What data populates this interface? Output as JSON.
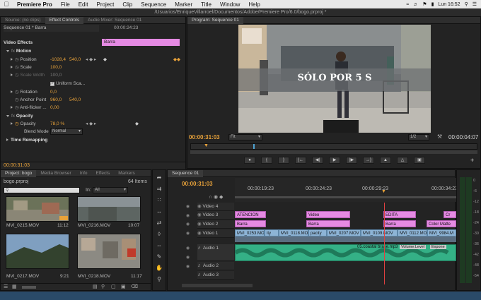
{
  "menubar": {
    "items": [
      "Premiere Pro",
      "File",
      "Edit",
      "Project",
      "Clip",
      "Sequence",
      "Marker",
      "Title",
      "Window",
      "Help"
    ],
    "clock": "Lun 16:52"
  },
  "window_title": "/Usuarios/EnriqueVillarroel/Documentos/Adobe/Premiere Pro/6.0/bogo.prproj *",
  "effect_controls": {
    "tabs": [
      "Source: (no clips)",
      "Effect Controls",
      "Audio Mixer: Sequence 01"
    ],
    "sequence_label": "Sequence 01 * Barra",
    "timecode_head": "00:00:24:23",
    "clip_name": "Barra",
    "video_effects": "Video Effects",
    "motion": "Motion",
    "position_label": "Position",
    "position_x": "-1028,4",
    "position_y": "540,0",
    "scale_label": "Scale",
    "scale_val": "100,0",
    "scale_width_label": "Scale Width",
    "scale_width_val": "100,0",
    "uniform_scale": "Uniform Sca...",
    "rotation_label": "Rotation",
    "rotation_val": "0,0",
    "anchor_label": "Anchor Point",
    "anchor_x": "960,0",
    "anchor_y": "540,0",
    "antiflicker_label": "Anti-flicker ...",
    "antiflicker_val": "0,00",
    "opacity_group": "Opacity",
    "opacity_label": "Opacity",
    "opacity_val": "78,0 %",
    "blend_label": "Blend Mode",
    "blend_val": "Normal",
    "time_remap": "Time Remapping",
    "timecode_foot": "00:00:31:03"
  },
  "program": {
    "tab": "Program: Sequence 01",
    "overlay_text": "SÓLO POR 5 S",
    "timecode": "00:00:31:03",
    "fit": "Fit",
    "quality": "1/2",
    "duration": "00:00:04:07"
  },
  "project": {
    "tabs": [
      "Project: bogo",
      "Media Browser",
      "Info",
      "Effects",
      "Markers"
    ],
    "file": "bogo.prproj",
    "count": "64 Items",
    "in_label": "In:",
    "in_val": "All",
    "items": [
      {
        "name": "MVI_0215.MOV",
        "dur": "11:12"
      },
      {
        "name": "MVI_0216.MOV",
        "dur": "10:07"
      },
      {
        "name": "MVI_0217.MOV",
        "dur": "9:21"
      },
      {
        "name": "MVI_0218.MOV",
        "dur": "11:17"
      }
    ]
  },
  "timeline": {
    "tab": "Sequence 01",
    "timecode": "00:00:31:03",
    "ruler": [
      "00:00:19:23",
      "00:00:24:23",
      "00:00:29:23",
      "00:00:34:23"
    ],
    "tracks": [
      "Video 4",
      "Video 3",
      "Video 2",
      "Video 1",
      "Audio 1",
      "Audio 2",
      "Audio 3"
    ],
    "v3_clips": [
      "ATENCION",
      "Video",
      "EDITA",
      "Cr"
    ],
    "v2_clips": [
      "Barra",
      "Barra",
      "Barra",
      "Color Matte"
    ],
    "v1_clips": [
      "MVI_0253.MOV",
      "ity",
      "MVI_0118.MOV",
      "pacity",
      "MVI_0207.MOV",
      "MVI_0109.MOV",
      "MVI_0112.MOV",
      "MVI_9984.M"
    ],
    "a1_clips": [
      "05.coastal brake.mp3",
      "Volume:Level",
      "Expone"
    ]
  },
  "meter_labels": [
    "0",
    "-6",
    "-12",
    "-18",
    "-24",
    "-30",
    "-36",
    "-42",
    "-48",
    "-54"
  ],
  "colors": {
    "accent": "#e8a23a",
    "pink": "#e58ae3",
    "blue": "#8db4d6",
    "green": "#34b086",
    "playhead": "#e04040"
  }
}
